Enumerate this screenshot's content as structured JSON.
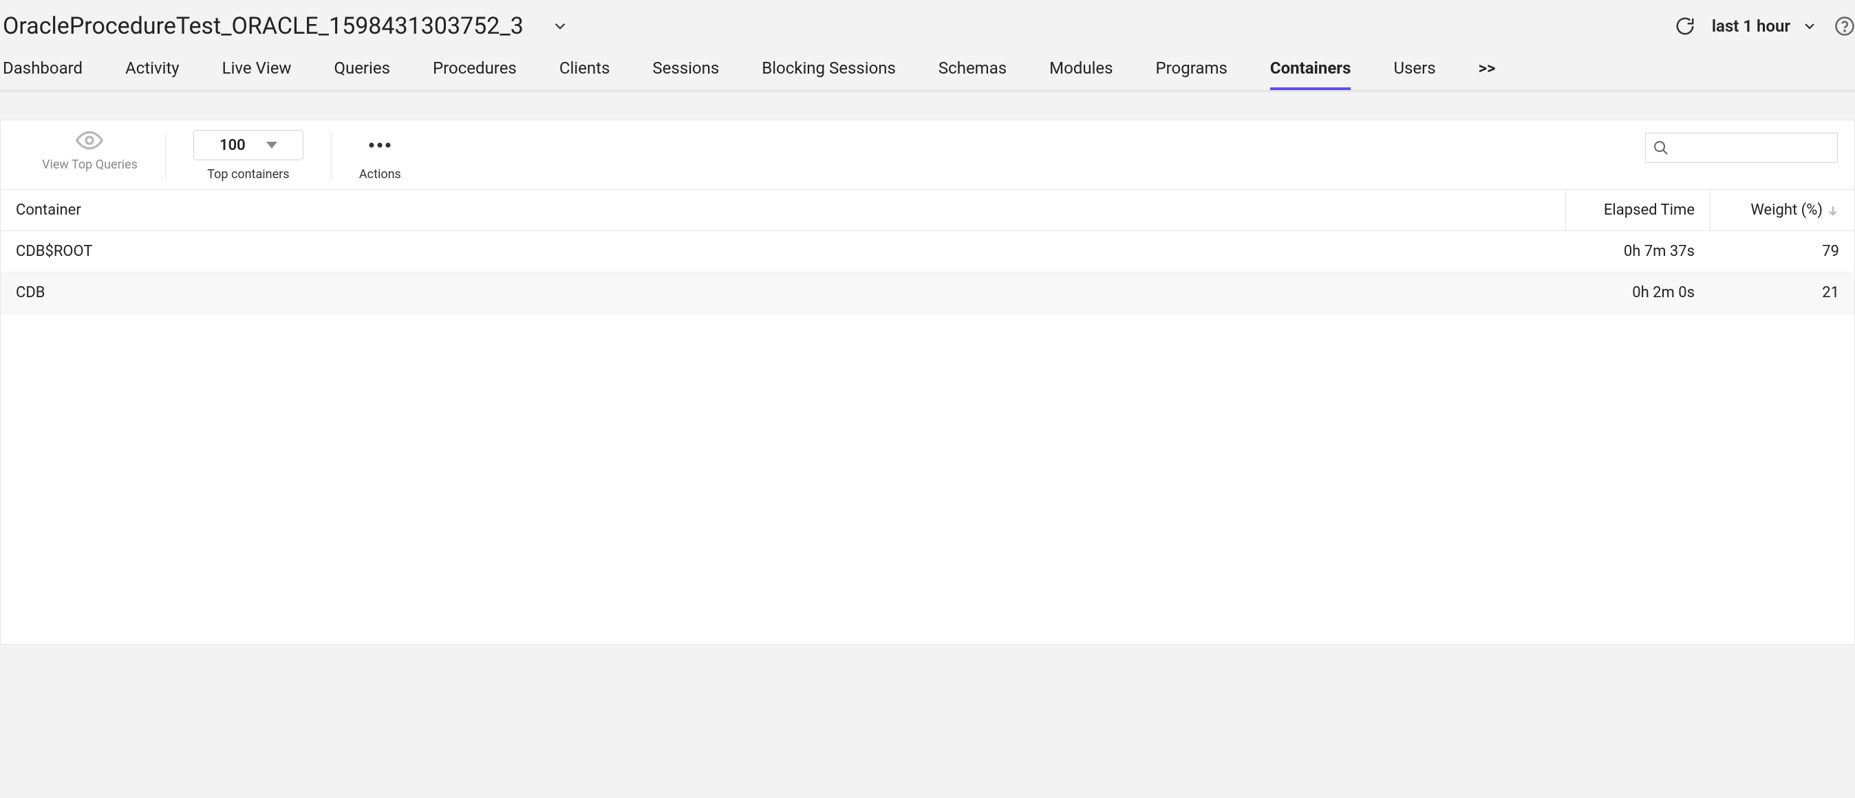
{
  "header": {
    "title": "OracleProcedureTest_ORACLE_1598431303752_3",
    "time_range": "last 1 hour"
  },
  "tabs": [
    {
      "label": "Dashboard",
      "active": false
    },
    {
      "label": "Activity",
      "active": false
    },
    {
      "label": "Live View",
      "active": false
    },
    {
      "label": "Queries",
      "active": false
    },
    {
      "label": "Procedures",
      "active": false
    },
    {
      "label": "Clients",
      "active": false
    },
    {
      "label": "Sessions",
      "active": false
    },
    {
      "label": "Blocking Sessions",
      "active": false
    },
    {
      "label": "Schemas",
      "active": false
    },
    {
      "label": "Modules",
      "active": false
    },
    {
      "label": "Programs",
      "active": false
    },
    {
      "label": "Containers",
      "active": true
    },
    {
      "label": "Users",
      "active": false
    },
    {
      "label": ">>",
      "active": false
    }
  ],
  "toolbar": {
    "view_top_queries": "View Top Queries",
    "top_containers": {
      "value": "100",
      "label": "Top containers"
    },
    "actions": "Actions",
    "search_placeholder": ""
  },
  "table": {
    "columns": {
      "c1": "Container",
      "c2": "Elapsed Time",
      "c3": "Weight (%)"
    },
    "rows": [
      {
        "container": "CDB$ROOT",
        "elapsed": "0h 7m 37s",
        "weight": "79"
      },
      {
        "container": "CDB",
        "elapsed": "0h 2m 0s",
        "weight": "21"
      }
    ]
  }
}
